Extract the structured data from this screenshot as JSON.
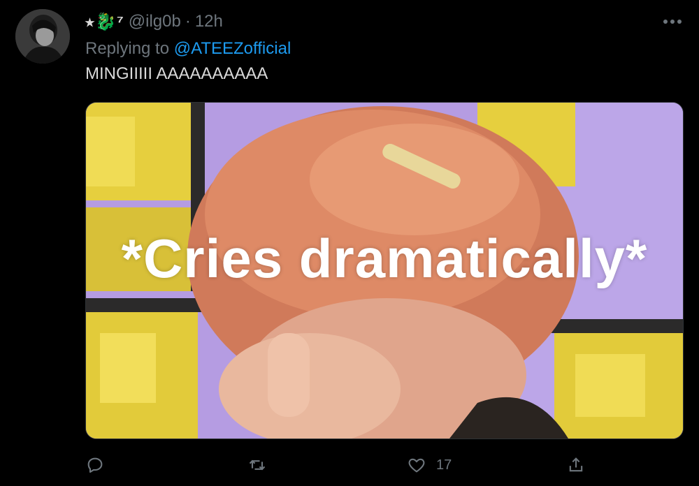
{
  "tweet": {
    "display_name": "⭑🐉⁷",
    "handle": "@ilg0b",
    "separator": "·",
    "time": "12h",
    "reply_prefix": "Replying to ",
    "reply_to": "@ATEEZofficial",
    "text": "MINGIIIII AAAAAAAAAA"
  },
  "media": {
    "caption": "*Cries dramatically*"
  },
  "actions": {
    "reply_icon": "reply-icon",
    "retweet_icon": "retweet-icon",
    "like_icon": "heart-icon",
    "like_count": "17",
    "share_icon": "share-icon"
  },
  "colors": {
    "background": "#000000",
    "text": "#d9d9d9",
    "muted": "#6e767d",
    "link": "#1d9bf0"
  }
}
